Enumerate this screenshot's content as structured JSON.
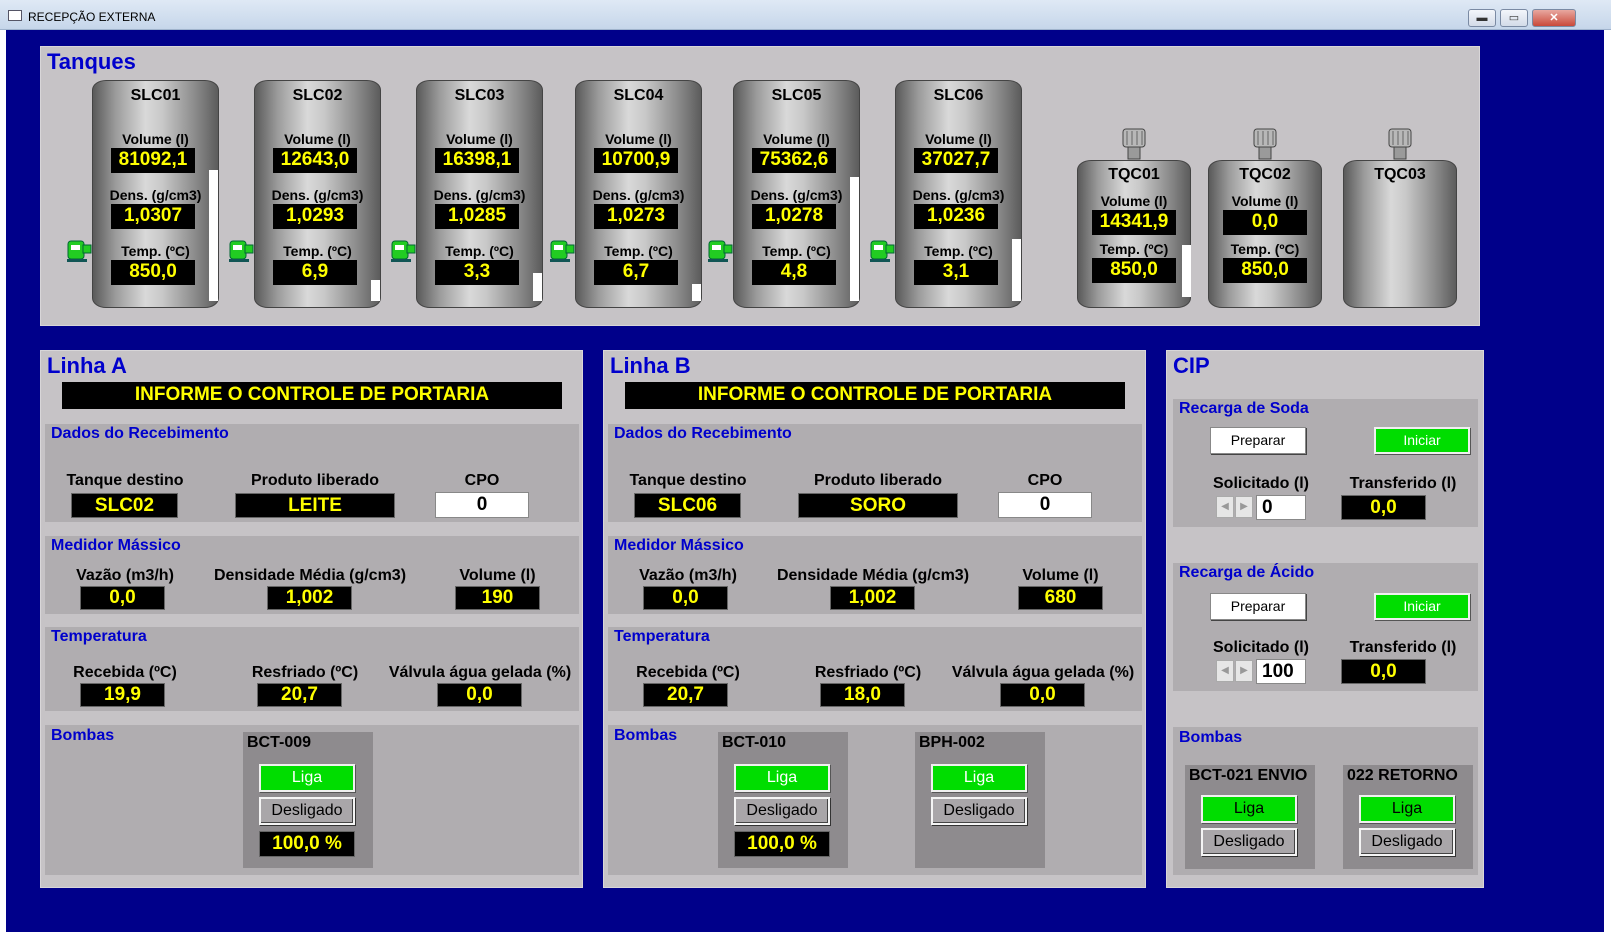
{
  "window": {
    "title": "RECEPÇÃO EXTERNA",
    "minimize": "▬",
    "maximize": "▭",
    "close": "✕"
  },
  "tanks_panel": {
    "title": "Tanques",
    "slc": [
      {
        "name": "SLC01",
        "volume_label": "Volume (l)",
        "volume": "81092,1",
        "dens_label": "Dens. (g/cm3)",
        "dens": "1,0307",
        "temp_label": "Temp. (ºC)",
        "temp": "850,0",
        "level": 0.76
      },
      {
        "name": "SLC02",
        "volume_label": "Volume (l)",
        "volume": "12643,0",
        "dens_label": "Dens. (g/cm3)",
        "dens": "1,0293",
        "temp_label": "Temp. (ºC)",
        "temp": "6,9",
        "level": 0.12
      },
      {
        "name": "SLC03",
        "volume_label": "Volume (l)",
        "volume": "16398,1",
        "dens_label": "Dens. (g/cm3)",
        "dens": "1,0285",
        "temp_label": "Temp. (ºC)",
        "temp": "3,3",
        "level": 0.16
      },
      {
        "name": "SLC04",
        "volume_label": "Volume (l)",
        "volume": "10700,9",
        "dens_label": "Dens. (g/cm3)",
        "dens": "1,0273",
        "temp_label": "Temp. (ºC)",
        "temp": "6,7",
        "level": 0.1
      },
      {
        "name": "SLC05",
        "volume_label": "Volume (l)",
        "volume": "75362,6",
        "dens_label": "Dens. (g/cm3)",
        "dens": "1,0278",
        "temp_label": "Temp. (ºC)",
        "temp": "4,8",
        "level": 0.72
      },
      {
        "name": "SLC06",
        "volume_label": "Volume (l)",
        "volume": "37027,7",
        "dens_label": "Dens. (g/cm3)",
        "dens": "1,0236",
        "temp_label": "Temp. (ºC)",
        "temp": "3,1",
        "level": 0.36
      }
    ],
    "tqc": [
      {
        "name": "TQC01",
        "volume_label": "Volume (l)",
        "volume": "14341,9",
        "temp_label": "Temp. (ºC)",
        "temp": "850,0",
        "level": 0.4
      },
      {
        "name": "TQC02",
        "volume_label": "Volume (l)",
        "volume": "0,0",
        "temp_label": "Temp. (ºC)",
        "temp": "850,0",
        "level": 0
      },
      {
        "name": "TQC03"
      }
    ]
  },
  "linha_a": {
    "title": "Linha   A",
    "banner": "INFORME O CONTROLE DE PORTARIA",
    "recebimento": {
      "title": "Dados do Recebimento",
      "tanque_label": "Tanque destino",
      "tanque": "SLC02",
      "produto_label": "Produto liberado",
      "produto": "LEITE",
      "cpo_label": "CPO",
      "cpo": "0"
    },
    "medidor": {
      "title": "Medidor Mássico",
      "vazao_label": "Vazão (m3/h)",
      "vazao": "0,0",
      "dens_label": "Densidade Média (g/cm3)",
      "dens": "1,002",
      "vol_label": "Volume (l)",
      "vol": "190"
    },
    "temperatura": {
      "title": "Temperatura",
      "rec_label": "Recebida (ºC)",
      "rec": "19,9",
      "resf_label": "Resfriado (ºC)",
      "resf": "20,7",
      "valv_label": "Válvula água gelada (%)",
      "valv": "0,0"
    },
    "bombas": {
      "title": "Bombas",
      "b1": {
        "name": "BCT-009",
        "liga": "Liga",
        "status": "Desligado",
        "pct": "100,0 %"
      }
    }
  },
  "linha_b": {
    "title": "Linha   B",
    "banner": "INFORME O CONTROLE DE PORTARIA",
    "recebimento": {
      "title": "Dados do Recebimento",
      "tanque_label": "Tanque destino",
      "tanque": "SLC06",
      "produto_label": "Produto liberado",
      "produto": "SORO",
      "cpo_label": "CPO",
      "cpo": "0"
    },
    "medidor": {
      "title": "Medidor Mássico",
      "vazao_label": "Vazão (m3/h)",
      "vazao": "0,0",
      "dens_label": "Densidade Média (g/cm3)",
      "dens": "1,002",
      "vol_label": "Volume (l)",
      "vol": "680"
    },
    "temperatura": {
      "title": "Temperatura",
      "rec_label": "Recebida (ºC)",
      "rec": "20,7",
      "resf_label": "Resfriado (ºC)",
      "resf": "18,0",
      "valv_label": "Válvula água gelada (%)",
      "valv": "0,0"
    },
    "bombas": {
      "title": "Bombas",
      "b1": {
        "name": "BCT-010",
        "liga": "Liga",
        "status": "Desligado",
        "pct": "100,0 %"
      },
      "b2": {
        "name": "BPH-002",
        "liga": "Liga",
        "status": "Desligado"
      }
    }
  },
  "cip": {
    "title": "CIP",
    "soda": {
      "title": "Recarga de Soda",
      "preparar": "Preparar",
      "iniciar": "Iniciar",
      "sol_label": "Solicitado (l)",
      "sol": "0",
      "transf_label": "Transferido (l)",
      "transf": "0,0"
    },
    "acido": {
      "title": "Recarga de Ácido",
      "preparar": "Preparar",
      "iniciar": "Iniciar",
      "sol_label": "Solicitado (l)",
      "sol": "100",
      "transf_label": "Transferido (l)",
      "transf": "0,0"
    },
    "bombas": {
      "title": "Bombas",
      "b1": {
        "name": "BCT-021 ENVIO",
        "liga": "Liga",
        "status": "Desligado"
      },
      "b2": {
        "name": "022 RETORNO",
        "liga": "Liga",
        "status": "Desligado"
      }
    },
    "spin_left": "◀",
    "spin_right": "▶"
  },
  "colors": {
    "frame": "#00008a",
    "panel": "#c6c3c6",
    "title_blue": "#0000cc",
    "value_yellow": "#ffff00",
    "button_green": "#00dd00",
    "pump_green": "#22cc22"
  }
}
